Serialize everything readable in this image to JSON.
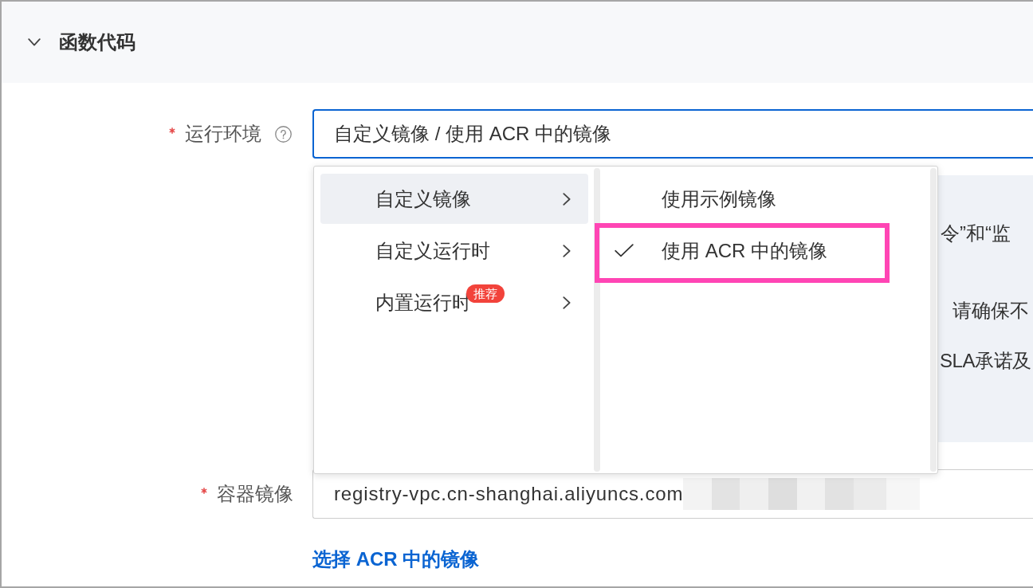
{
  "section": {
    "title": "函数代码",
    "expanded": true
  },
  "runtime_field": {
    "label": "运行环境",
    "required": true,
    "help": true,
    "value": "自定义镜像 / 使用 ACR 中的镜像",
    "focused": true
  },
  "cascader": {
    "columns": [
      {
        "kind": "branch",
        "items": [
          {
            "label": "自定义镜像",
            "selected": true,
            "highlighted": false
          },
          {
            "label": "自定义运行时",
            "selected": false,
            "highlighted": false
          },
          {
            "label": "内置运行时",
            "badge": "推荐",
            "selected": false,
            "highlighted": false
          }
        ]
      },
      {
        "kind": "leaf",
        "items": [
          {
            "label": "使用示例镜像",
            "selected": false,
            "highlighted": false
          },
          {
            "label": "使用 ACR 中的镜像",
            "selected": true,
            "highlighted": true
          }
        ]
      }
    ]
  },
  "info_panel": {
    "lines": [
      "令”和“监",
      "请确保不",
      "SLA承诺及"
    ]
  },
  "image_field": {
    "label": "容器镜像",
    "required": true,
    "value": "registry-vpc.cn-shanghai.aliyuncs.com",
    "redacted": true
  },
  "link": {
    "label": "选择 ACR 中的镜像"
  }
}
